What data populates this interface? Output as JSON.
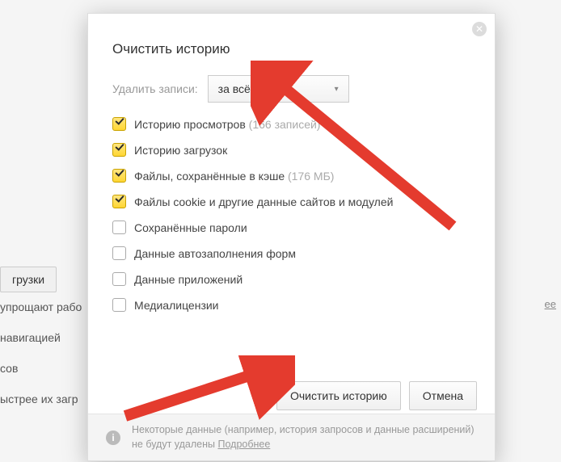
{
  "bg": {
    "btn_downloads": "грузки",
    "frag1": "упрощают рабо",
    "frag2": "навигацией",
    "frag3": "сов",
    "frag4": "ыстрее их загр",
    "link": "ее"
  },
  "dialog": {
    "title": "Очистить историю",
    "range_label": "Удалить записи:",
    "range_value": "за всё время",
    "checks": [
      {
        "label": "Историю просмотров",
        "sub": "(166 записей)",
        "checked": true
      },
      {
        "label": "Историю загрузок",
        "sub": "",
        "checked": true
      },
      {
        "label": "Файлы, сохранённые в кэше",
        "sub": "(176 МБ)",
        "checked": true
      },
      {
        "label": "Файлы cookie и другие данные сайтов и модулей",
        "sub": "",
        "checked": true
      },
      {
        "label": "Сохранённые пароли",
        "sub": "",
        "checked": false
      },
      {
        "label": "Данные автозаполнения форм",
        "sub": "",
        "checked": false
      },
      {
        "label": "Данные приложений",
        "sub": "",
        "checked": false
      },
      {
        "label": "Медиалицензии",
        "sub": "",
        "checked": false
      }
    ],
    "btn_clear": "Очистить историю",
    "btn_cancel": "Отмена",
    "footer_text_a": "Некоторые данные (например, история запросов и данные расширений) не будут удалены ",
    "footer_link": "Подробнее"
  }
}
